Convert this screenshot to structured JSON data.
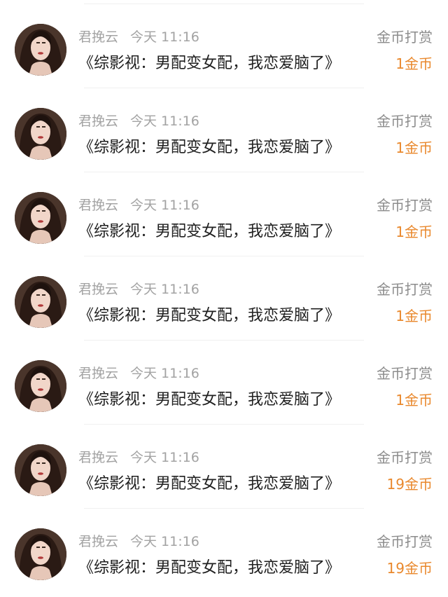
{
  "rows": [
    {
      "name": "君挽云",
      "time": "今天 11:16",
      "title": "《综影视：男配变女配，我恋爱脑了》",
      "reward_label": "金币打赏",
      "reward_amount": "1金币"
    },
    {
      "name": "君挽云",
      "time": "今天 11:16",
      "title": "《综影视：男配变女配，我恋爱脑了》",
      "reward_label": "金币打赏",
      "reward_amount": "1金币"
    },
    {
      "name": "君挽云",
      "time": "今天 11:16",
      "title": "《综影视：男配变女配，我恋爱脑了》",
      "reward_label": "金币打赏",
      "reward_amount": "1金币"
    },
    {
      "name": "君挽云",
      "time": "今天 11:16",
      "title": "《综影视：男配变女配，我恋爱脑了》",
      "reward_label": "金币打赏",
      "reward_amount": "1金币"
    },
    {
      "name": "君挽云",
      "time": "今天 11:16",
      "title": "《综影视：男配变女配，我恋爱脑了》",
      "reward_label": "金币打赏",
      "reward_amount": "1金币"
    },
    {
      "name": "君挽云",
      "time": "今天 11:16",
      "title": "《综影视：男配变女配，我恋爱脑了》",
      "reward_label": "金币打赏",
      "reward_amount": "19金币"
    },
    {
      "name": "君挽云",
      "time": "今天 11:16",
      "title": "《综影视：男配变女配，我恋爱脑了》",
      "reward_label": "金币打赏",
      "reward_amount": "19金币"
    }
  ],
  "colors": {
    "meta_text": "#a3a3a3",
    "title_text": "#1f1f1f",
    "reward_label": "#8c8c8c",
    "reward_amount": "#e9882c",
    "divider": "#f0f0f0"
  },
  "icons": {
    "avatar": "user-avatar-photo"
  }
}
